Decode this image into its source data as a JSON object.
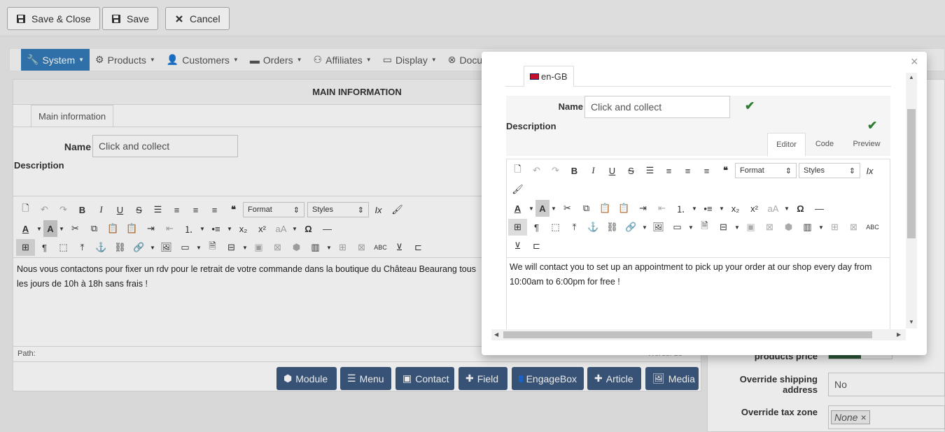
{
  "toolbar": {
    "save_close": "Save & Close",
    "save": "Save",
    "cancel": "Cancel"
  },
  "nav": [
    "System",
    "Products",
    "Customers",
    "Orders",
    "Affiliates",
    "Display",
    "Documentation"
  ],
  "main": {
    "panel_title": "MAIN INFORMATION",
    "tab": "Main information",
    "name_label": "Name",
    "name_value": "Click and collect",
    "description_label": "Description",
    "format_label": "Format",
    "styles_label": "Styles",
    "content": "Nous vous contactons pour fixer un rdv pour le retrait de votre commande dans la boutique du Château Beaurang tous les jours de 10h à 18h sans frais !",
    "path_label": "Path:",
    "words": "Words: 28"
  },
  "plugin_buttons": [
    "Module",
    "Menu",
    "Contact",
    "Field",
    "EngageBox",
    "Article",
    "Media"
  ],
  "right": {
    "products_price_label": "products price",
    "override_shipping_label": "Override shipping address",
    "override_shipping_value": "No",
    "override_tax_label": "Override tax zone",
    "override_tax_value": "None"
  },
  "modal": {
    "lang_tab": "en-GB",
    "name_label": "Name",
    "name_value": "Click and collect",
    "description_label": "Description",
    "tabs": [
      "Editor",
      "Code",
      "Preview"
    ],
    "format_label": "Format",
    "styles_label": "Styles",
    "content": "We will contact you to set up an appointment to pick up your order at our shop every day from 10:00am to 6:00pm for free !",
    "close": "×"
  },
  "colors": {
    "active_nav": "#337ab7",
    "plugin_button": "#3d5a80",
    "check": "#2e7d32"
  }
}
